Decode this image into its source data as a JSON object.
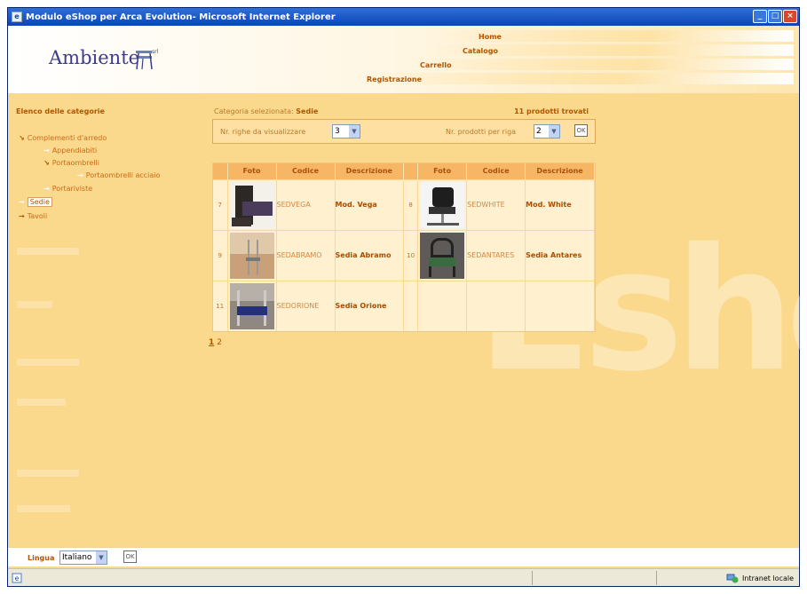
{
  "window": {
    "title": "Modulo eShop per Arca Evolution- Microsoft Internet Explorer"
  },
  "brand": {
    "logo_text": "Ambiente",
    "logo_sup": "srl"
  },
  "nav": {
    "home": "Home",
    "catalogo": "Catalogo",
    "carrello": "Carrello",
    "registrazione": "Registrazione"
  },
  "sidebar": {
    "title": "Elenco delle categorie",
    "items": [
      {
        "label": "Complementi d'arredo"
      },
      {
        "label": "Appendiabiti"
      },
      {
        "label": "Portaombrelli"
      },
      {
        "label": "Portaombrelli acciaio"
      },
      {
        "label": "Portariviste"
      },
      {
        "label": "Sedie"
      },
      {
        "label": "Tavoli"
      }
    ]
  },
  "content": {
    "selected_label": "Categoria selezionata:",
    "selected_value": "Sedie",
    "found": "11 prodotti trovati",
    "rows_label": "Nr. righe da visualizzare",
    "rows_value": "3",
    "per_row_label": "Nr. prodotti per riga",
    "per_row_value": "2"
  },
  "table": {
    "headers": [
      "Foto",
      "Codice",
      "Descrizione",
      "Foto",
      "Codice",
      "Descrizione"
    ],
    "rows": [
      {
        "left": {
          "num": "7",
          "code": "SEDVEGA",
          "desc": "Mod. Vega"
        },
        "right": {
          "num": "8",
          "code": "SEDWHITE",
          "desc": "Mod. White"
        }
      },
      {
        "left": {
          "num": "9",
          "code": "SEDABRAMO",
          "desc": "Sedia Abramo"
        },
        "right": {
          "num": "10",
          "code": "SEDANTARES",
          "desc": "Sedia Antares"
        }
      },
      {
        "left": {
          "num": "11",
          "code": "SEDORIONE",
          "desc": "Sedia Orione"
        },
        "right": {
          "num": "",
          "code": "",
          "desc": ""
        }
      }
    ]
  },
  "pager": {
    "pages": [
      "1",
      "2"
    ],
    "current": "1"
  },
  "footer": {
    "lang_label": "Lingua",
    "lang_value": "Italiano"
  },
  "status": {
    "zone": "Intranet locale"
  },
  "watermark": "Esho",
  "icons": {
    "app": "ie-icon",
    "minimize": "minimize-icon",
    "maximize": "maximize-icon",
    "close": "close-icon",
    "arrow": "arrow-right-icon",
    "go": "go-icon",
    "intranet": "intranet-icon"
  },
  "colors": {
    "accent": "#b25400",
    "page_bg": "#fbd98c",
    "header_row": "#f7b665"
  }
}
